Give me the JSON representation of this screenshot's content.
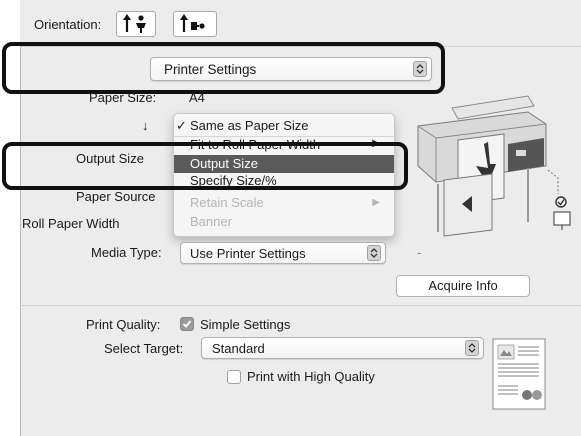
{
  "orientation": {
    "label": "Orientation:"
  },
  "settings_popup": {
    "value": "Printer Settings"
  },
  "paper_size": {
    "label": "Paper Size:",
    "value": "A4"
  },
  "output_size_arrow": "↓",
  "output_size": {
    "label": "Output Size"
  },
  "paper_source": {
    "label": "Paper Source"
  },
  "roll_paper_width": {
    "label": "Roll Paper Width"
  },
  "menu": {
    "items": [
      {
        "label": "Same as Paper Size",
        "check": "✓",
        "state": "checked"
      },
      {
        "label": "Fit to Roll Paper Width",
        "arrow": "▶",
        "state": "clipped"
      },
      {
        "label": "Output Size",
        "state": "selected"
      },
      {
        "label": "Specify Size/%",
        "state": "clipped"
      },
      {
        "label": "Retain Scale",
        "arrow": "▶",
        "state": "disabled"
      },
      {
        "label": "Banner",
        "state": "disabled"
      }
    ]
  },
  "media_type": {
    "label": "Media Type:",
    "value": "Use Printer Settings",
    "dash": "-"
  },
  "acquire_info": {
    "label": "Acquire Info"
  },
  "print_quality": {
    "label": "Print Quality:",
    "checkbox_label": "Simple Settings",
    "checked": true
  },
  "select_target": {
    "label": "Select Target:",
    "value": "Standard"
  },
  "high_quality": {
    "label": "Print with High Quality",
    "checked": false
  },
  "colors": {
    "selection": "#5a5a5a",
    "highlight_border": "#111111",
    "accent_check": "#9a9a9a"
  }
}
